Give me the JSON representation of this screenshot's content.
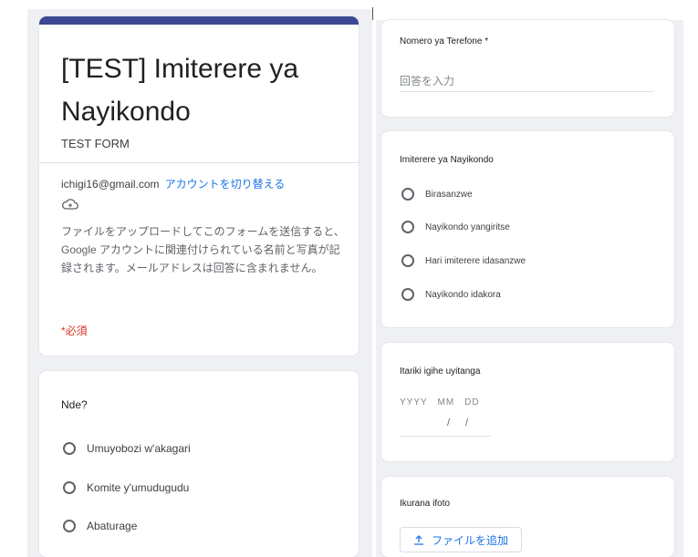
{
  "form": {
    "title": "[TEST] Imiterere ya Nayikondo",
    "description": "TEST FORM",
    "account_email": "ichigi16@gmail.com",
    "switch_account": "アカウントを切り替える",
    "upload_notice": "ファイルをアップロードしてこのフォームを送信すると、Google アカウントに関連付けられている名前と写真が記録されます。メールアドレスは回答に含まれません。",
    "required_label": "*必須"
  },
  "q_nde": {
    "label": "Nde?",
    "options": [
      "Umuyobozi w'akagari",
      "Komite y'umudugudu",
      "Abaturage"
    ]
  },
  "q_phone": {
    "label": "Nomero ya Terefone *",
    "placeholder": "回答を入力"
  },
  "q_status": {
    "label": "Imiterere ya Nayikondo",
    "options": [
      "Birasanzwe",
      "Nayikondo yangiritse",
      "Hari imiterere idasanzwe",
      "Nayikondo idakora"
    ]
  },
  "q_date": {
    "label": "Itariki igihe uyitanga",
    "placeholder": "YYYY　MM　DD",
    "sep1": "/",
    "sep2": "/"
  },
  "q_photo": {
    "label": "Ikurana ifoto",
    "button_label": "ファイルを追加"
  },
  "colors": {
    "accent_bar": "#3b4894",
    "link": "#1a73e8",
    "required": "#d93025",
    "background": "#eef0f3"
  },
  "icons": {
    "upload_notice": "cloud-icon",
    "upload_button": "upload-icon"
  }
}
